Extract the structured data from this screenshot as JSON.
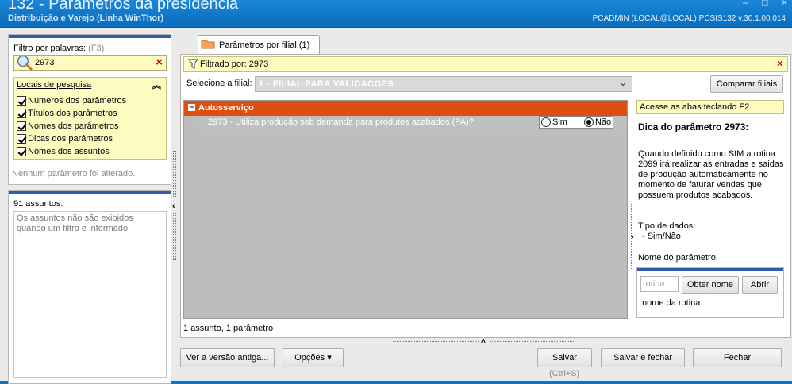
{
  "window": {
    "title": "132 - Parâmetros da presidência",
    "subtitle": "Distribuição e Varejo (Linha WinThor)",
    "user_info": "PCADMIN (LOCAL@LOCAL)   PCSIS132  v.30.1.00.014"
  },
  "filter": {
    "label": "Filtro por palavras:",
    "shortcut": "(F3)",
    "search_value": "2973",
    "clear_icon": "×"
  },
  "locals": {
    "title": "Locais de pesquisa",
    "items": [
      {
        "label": "Números dos parâmetros",
        "checked": true
      },
      {
        "label": "Títulos dos parâmetros",
        "checked": true
      },
      {
        "label": "Nomes dos parâmetros",
        "checked": true
      },
      {
        "label": "Dicas dos parâmetros",
        "checked": true
      },
      {
        "label": "Nomes dos assuntos",
        "checked": true
      }
    ]
  },
  "no_change_msg": "Nenhum parâmetro foi alterado.",
  "assuntos": {
    "count": "91 assuntos:",
    "message": "Os assuntos não são exibidos quando um filtro é informado."
  },
  "tab": {
    "label": "Parâmetros por filial  (1)"
  },
  "filtered": {
    "text": "Filtrado por: 2973",
    "close": "×"
  },
  "filial": {
    "label": "Selecione a filial:",
    "value": "1 - FILIAL PARA VALIDACOES",
    "compare_button": "Comparar filiais"
  },
  "grid": {
    "group_toggle": "−",
    "group_title": "Autosserviço",
    "param_text": "2973 - Utiliza produção sob demanda para produtos acabados (PA)?",
    "options": [
      {
        "label": "Sim",
        "selected": false
      },
      {
        "label": "Não",
        "selected": true
      }
    ]
  },
  "status": "1 assunto, 1 parâmetro",
  "info": {
    "hint": "Acesse as abas teclando F2",
    "tip_title": "Dica do parâmetro 2973:",
    "tip_body": "Quando definido como SIM a rotina 2099 irá realizar as entradas e saidas de produção automaticamente no momento de faturar vendas que possuem produtos acabados.",
    "data_type_label": "Tipo de dados:",
    "data_type_value": "- Sim/Não",
    "param_name_label": "Nome do parâmetro:",
    "rotina_placeholder": "rotina",
    "obter_button": "Obter nome",
    "abrir_button": "Abrir",
    "rotina_name": "nome da rotina"
  },
  "buttons": {
    "old_version": "Ver a versão antiga...",
    "options": "Opções ▾",
    "save": "Salvar",
    "save_shortcut": "(Ctrl+S)",
    "save_close": "Salvar e fechar",
    "close": "Fechar"
  }
}
